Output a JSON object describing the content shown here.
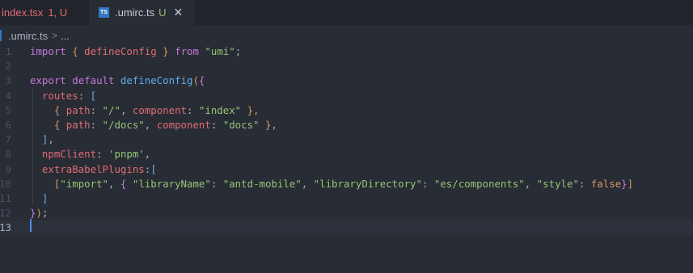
{
  "tabs": [
    {
      "label": "index.tsx",
      "status": "1, U",
      "active": false
    },
    {
      "label": ".umirc.ts",
      "status": "U",
      "active": true,
      "icon": "TS"
    }
  ],
  "breadcrumb": {
    "file": ".umirc.ts",
    "separator": ">",
    "more": "..."
  },
  "editor": {
    "line_numbers": [
      "1",
      "2",
      "3",
      "4",
      "5",
      "6",
      "7",
      "8",
      "9",
      "10",
      "11",
      "12",
      "13"
    ],
    "current_line": 13,
    "colors": {
      "background": "#282c34",
      "keyword": "#c678dd",
      "string": "#98c379",
      "property": "#e06c75",
      "function": "#61afef",
      "cursor": "#528bff"
    }
  },
  "code": {
    "l1": {
      "kw_import": "import",
      "b_open": "{",
      "fn": "defineConfig",
      "b_close": "}",
      "kw_from": "from",
      "str": "\"umi\"",
      "semi": ";"
    },
    "l3": {
      "kw_export": "export",
      "kw_default": "default",
      "fn": "defineConfig",
      "paren": "(",
      "brace": "{"
    },
    "l4": {
      "prop": "routes",
      "colon": ": ",
      "bracket": "["
    },
    "l5": {
      "open": "{",
      "k1": "path",
      "c1": ": ",
      "v1": "\"/\"",
      "comma": ", ",
      "k2": "component",
      "c2": ": ",
      "v2": "\"index\"",
      "close": " },"
    },
    "l6": {
      "open": "{",
      "k1": "path",
      "c1": ": ",
      "v1": "\"/docs\"",
      "comma": ", ",
      "k2": "component",
      "c2": ": ",
      "v2": "\"docs\"",
      "close": " },"
    },
    "l7": {
      "bracket": "]",
      "comma": ","
    },
    "l8": {
      "prop": "npmClient",
      "colon": ": ",
      "str": "'pnpm'",
      "comma": ","
    },
    "l9": {
      "prop": "extraBabelPlugins",
      "colon": ":",
      "bracket": "["
    },
    "l10": {
      "open": "[",
      "s1": "\"import\"",
      "comma1": ", ",
      "brace": "{",
      "k1": "\"libraryName\"",
      "c1": ": ",
      "v1": "\"antd-mobile\"",
      "comma2": ", ",
      "k2": "\"libraryDirectory\"",
      "c2": ": ",
      "v2": "\"es/components\"",
      "comma3": ", ",
      "k3": "\"style\"",
      "c3": ": ",
      "v3": "false",
      "close_brace": "}",
      "close": "]"
    },
    "l11": {
      "bracket": "]"
    },
    "l12": {
      "brace": "}",
      "paren": ")",
      "semi": ";"
    }
  }
}
